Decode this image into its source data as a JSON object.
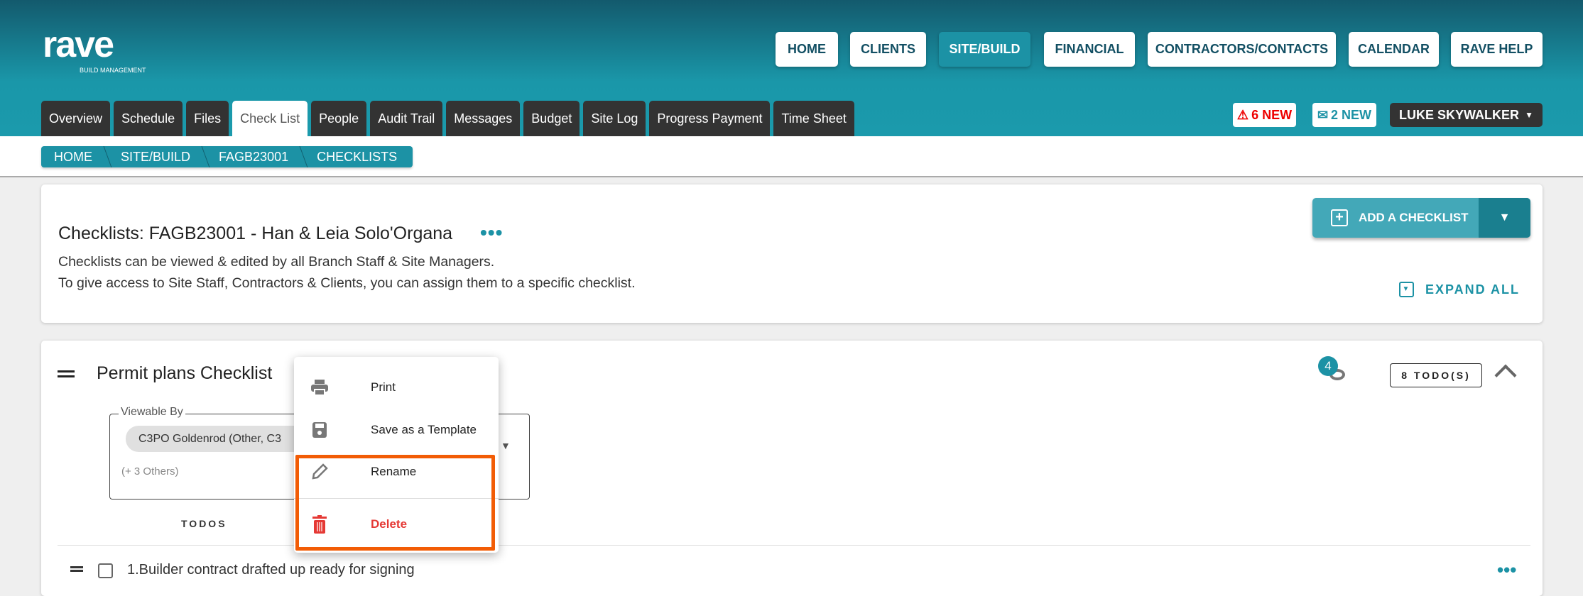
{
  "brand": {
    "logo_text": "rave",
    "tagline": "BUILD MANAGEMENT"
  },
  "nav": [
    "HOME",
    "CLIENTS",
    "SITE/BUILD",
    "FINANCIAL",
    "CONTRACTORS/CONTACTS",
    "CALENDAR",
    "RAVE HELP"
  ],
  "nav_active": "SITE/BUILD",
  "tabs": [
    "Overview",
    "Schedule",
    "Files",
    "Check List",
    "People",
    "Audit Trail",
    "Messages",
    "Budget",
    "Site Log",
    "Progress Payment",
    "Time Sheet"
  ],
  "tab_active": "Check List",
  "alerts": {
    "warnings": "6 NEW",
    "messages": "2 NEW",
    "user": "LUKE SKYWALKER"
  },
  "breadcrumb": [
    "HOME",
    "SITE/BUILD",
    "FAGB23001",
    "CHECKLISTS"
  ],
  "summary": {
    "title": "Checklists: FAGB23001 - Han & Leia Solo'Organa",
    "line1": "Checklists can be viewed & edited by all Branch Staff & Site Managers.",
    "line2": "To give access to Site Staff, Contractors & Clients, you can assign them to a specific checklist.",
    "add_button": "ADD A CHECKLIST",
    "expand_all": "EXPAND ALL"
  },
  "checklist": {
    "title": "Permit plans Checklist",
    "viewers_count": "4",
    "todo_count": "8 TODO(S)",
    "viewable_label": "Viewable By",
    "chip": "C3PO Goldenrod (Other, C3",
    "others": "(+ 3 Others)",
    "todos_header": "TODOS",
    "items": [
      "1.Builder contract drafted up ready for signing"
    ]
  },
  "menu": {
    "print": "Print",
    "save_template": "Save as a Template",
    "rename": "Rename",
    "delete": "Delete"
  },
  "colors": {
    "accent": "#1c92a5",
    "danger": "#e53935",
    "highlight": "#f25c05"
  }
}
